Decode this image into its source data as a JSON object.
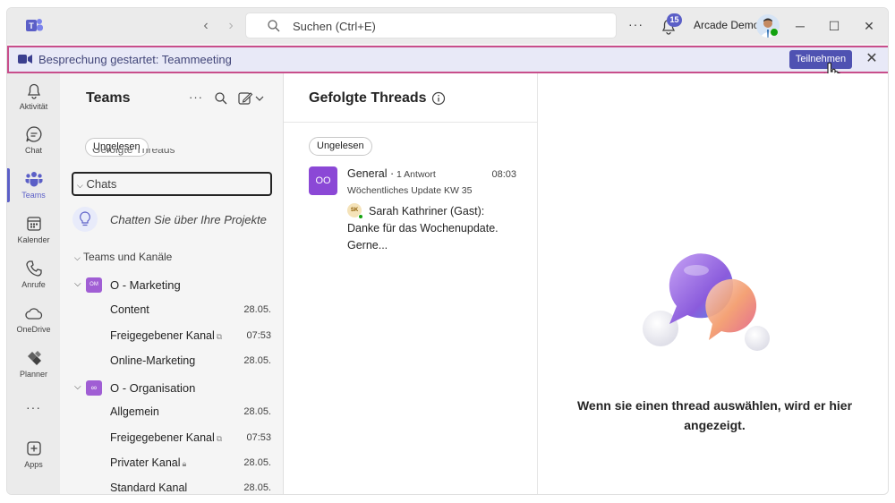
{
  "titlebar": {
    "search_placeholder": "Suchen (Ctrl+E)",
    "notification_count": "15",
    "user_name": "Arcade Demo",
    "more_label": "···"
  },
  "banner": {
    "text": "Besprechung gestartet: Teammeeting",
    "join_label": "Teilnehmen"
  },
  "rail": {
    "items": [
      {
        "label": "Aktivität",
        "icon": "bell-icon"
      },
      {
        "label": "Chat",
        "icon": "chat-icon"
      },
      {
        "label": "Teams",
        "icon": "teams-icon"
      },
      {
        "label": "Kalender",
        "icon": "calendar-icon"
      },
      {
        "label": "Anrufe",
        "icon": "phone-icon"
      },
      {
        "label": "OneDrive",
        "icon": "cloud-icon"
      },
      {
        "label": "Planner",
        "icon": "planner-icon"
      },
      {
        "label": "Apps",
        "icon": "add-apps-icon"
      }
    ],
    "more_label": "···"
  },
  "panel": {
    "title": "Teams",
    "filter_chip": "Ungelesen",
    "cut_item": "Gefolgte Threads",
    "chats_label": "Chats",
    "chat_projects": "Chatten Sie über Ihre Projekte",
    "teams_section": "Teams und Kanäle",
    "teams": [
      {
        "abbr": "OM",
        "name": "O - Marketing",
        "channels": [
          {
            "name": "Content",
            "date": "28.05."
          },
          {
            "name": "Freigegebener Kanal",
            "date": "07:53"
          },
          {
            "name": "Online-Marketing",
            "date": "28.05."
          }
        ]
      },
      {
        "abbr": "∞",
        "name": "O - Organisation",
        "channels": [
          {
            "name": "Allgemein",
            "date": "28.05."
          },
          {
            "name": "Freigegebener Kanal",
            "date": "07:53"
          },
          {
            "name": "Privater Kanal",
            "date": "28.05."
          },
          {
            "name": "Standard Kanal",
            "date": "28.05."
          }
        ]
      }
    ]
  },
  "threads": {
    "title": "Gefolgte Threads",
    "filter_chip": "Ungelesen",
    "items": [
      {
        "tile": "OO",
        "channel": "General",
        "replies": "1 Antwort",
        "time": "08:03",
        "subject": "Wöchentliches Update KW 35",
        "avatar": "SK",
        "preview": "Sarah Kathriner (Gast): Danke für das Wochenupdate. Gerne..."
      }
    ]
  },
  "detail": {
    "message": "Wenn sie einen thread auswählen, wird er hier angezeigt."
  },
  "colors": {
    "accent": "#5b5fc7",
    "banner_bg": "#e8e9f7",
    "banner_border": "#c84e8b",
    "join_button": "#4f52b2"
  }
}
